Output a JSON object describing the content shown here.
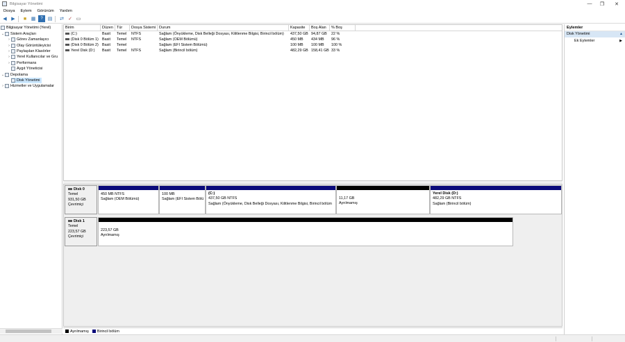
{
  "window": {
    "title": "Bilgisayar Yönetimi",
    "controls": [
      "—",
      "❐",
      "✕"
    ]
  },
  "menu": [
    "Dosya",
    "Eylem",
    "Görünüm",
    "Yardım"
  ],
  "toolbar": [
    "back-icon",
    "forward-icon",
    "up-folder-icon",
    "show-hide-tree-icon",
    "help-icon",
    "properties-icon",
    "connect-icon",
    "checklist-icon",
    "view-icon"
  ],
  "tree": {
    "root": "Bilgisayar Yönetimi (Yerel)",
    "items": [
      {
        "label": "Bilgisayar Yönetimi (Yerel)",
        "level": 0,
        "chevron": ""
      },
      {
        "label": "Sistem Araçları",
        "level": 1,
        "chevron": "⌄"
      },
      {
        "label": "Görev Zamanlayıcı",
        "level": 2,
        "chevron": "›"
      },
      {
        "label": "Olay Görüntüleyicisi",
        "level": 2,
        "chevron": "›"
      },
      {
        "label": "Paylaşılan Klasörler",
        "level": 2,
        "chevron": "›"
      },
      {
        "label": "Yerel Kullanıcılar ve Gru",
        "level": 2,
        "chevron": "›"
      },
      {
        "label": "Performans",
        "level": 2,
        "chevron": "›"
      },
      {
        "label": "Aygıt Yöneticisi",
        "level": 2,
        "chevron": ""
      },
      {
        "label": "Depolama",
        "level": 1,
        "chevron": "⌄"
      },
      {
        "label": "Disk Yönetimi",
        "level": 2,
        "chevron": "",
        "selected": true
      },
      {
        "label": "Hizmetler ve Uygulamalar",
        "level": 1,
        "chevron": "›"
      }
    ]
  },
  "volume_list": {
    "headers": [
      "Birim",
      "Düzen",
      "Tür",
      "Dosya Sistemi",
      "Durum",
      "Kapasite",
      "Boş Alan",
      "% Boş"
    ],
    "rows": [
      [
        "(C:)",
        "Basit",
        "Temel",
        "NTFS",
        "Sağlam (Önyükleme, Disk Belleği Dosyası, Kilitlenme Bilgisi, Birincil bölüm)",
        "437,50 GB",
        "94,87 GB",
        "22 %"
      ],
      [
        "(Disk 0 Bölüm 1)",
        "Basit",
        "Temel",
        "NTFS",
        "Sağlam (OEM Bölümü)",
        "450 MB",
        "434 MB",
        "96 %"
      ],
      [
        "(Disk 0 Bölüm 2)",
        "Basit",
        "Temel",
        "",
        "Sağlam (EFI Sistem Bölümü)",
        "100 MB",
        "100 MB",
        "100 %"
      ],
      [
        "Yerel Disk (D:)",
        "Basit",
        "Temel",
        "NTFS",
        "Sağlam (Birincil bölüm)",
        "482,29 GB",
        "158,41 GB",
        "33 %"
      ]
    ]
  },
  "disks": [
    {
      "name": "Disk 0",
      "type": "Temel",
      "size": "931,50 GB",
      "status": "Çevrimiçi",
      "partitions": [
        {
          "title": "",
          "line1": "450 MB NTFS",
          "line2": "Sağlam (OEM Bölümü)",
          "kind": "primary"
        },
        {
          "title": "",
          "line1": "100 MB",
          "line2": "Sağlam (EFI Sistem Bölü",
          "kind": "primary"
        },
        {
          "title": "(C:)",
          "line1": "437,50 GB NTFS",
          "line2": "Sağlam (Önyükleme, Disk Belleği Dosyası, Kilitlenme Bilgisi, Birincil bölüm",
          "kind": "primary"
        },
        {
          "title": "",
          "line1": "11,17 GB",
          "line2": "Ayrılmamış",
          "kind": "unallocated"
        },
        {
          "title": "Yerel Disk (D:)",
          "line1": "482,29 GB NTFS",
          "line2": "Sağlam (Birincil bölüm)",
          "kind": "primary"
        }
      ]
    },
    {
      "name": "Disk 1",
      "type": "Temel",
      "size": "223,57 GB",
      "status": "Çevrimiçi",
      "partitions": [
        {
          "title": "",
          "line1": "223,57 GB",
          "line2": "Ayrılmamış",
          "kind": "unallocated"
        }
      ]
    }
  ],
  "legend": [
    {
      "label": "Ayrılmamış",
      "color": "#000000"
    },
    {
      "label": "Birincil bölüm",
      "color": "#0a0a7a"
    }
  ],
  "actions": {
    "header": "Eylemler",
    "section": "Disk Yönetimi",
    "items": [
      "Ek Eylemler"
    ]
  },
  "colors": {
    "primary_bar": "#0a0a7a",
    "unallocated_bar": "#000000",
    "selection": "#cce8ff"
  }
}
